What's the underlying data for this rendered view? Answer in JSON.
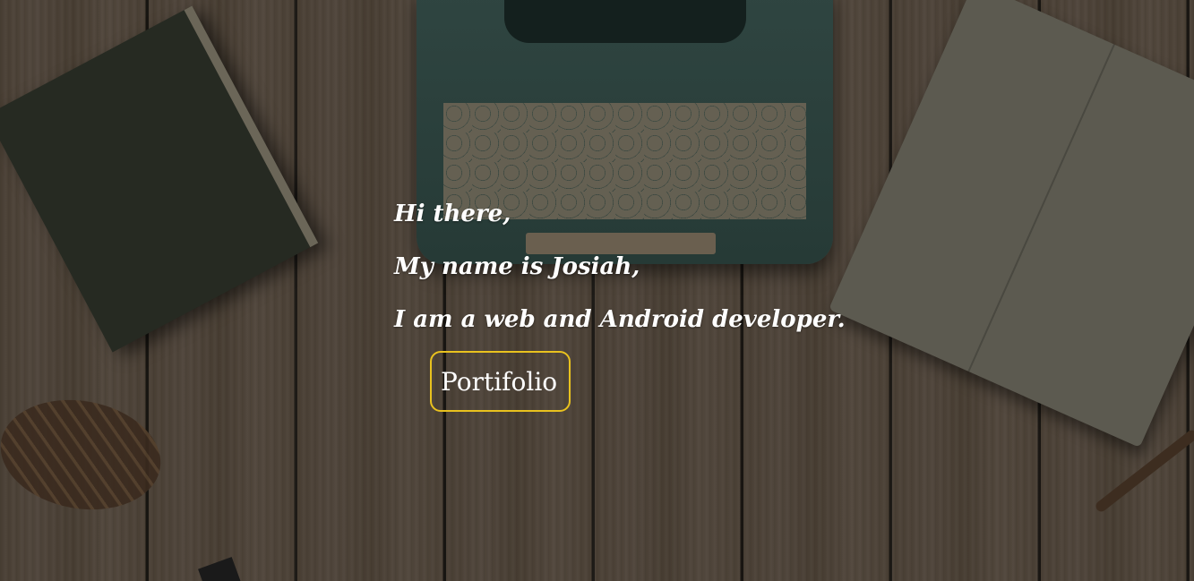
{
  "hero": {
    "greeting": "Hi there,",
    "name_line": "My name is Josiah,",
    "role_line": "I am a web and Android developer.",
    "portfolio_button": "Portifolio"
  },
  "colors": {
    "button_border": "#e9c21e",
    "text": "#ffffff"
  }
}
